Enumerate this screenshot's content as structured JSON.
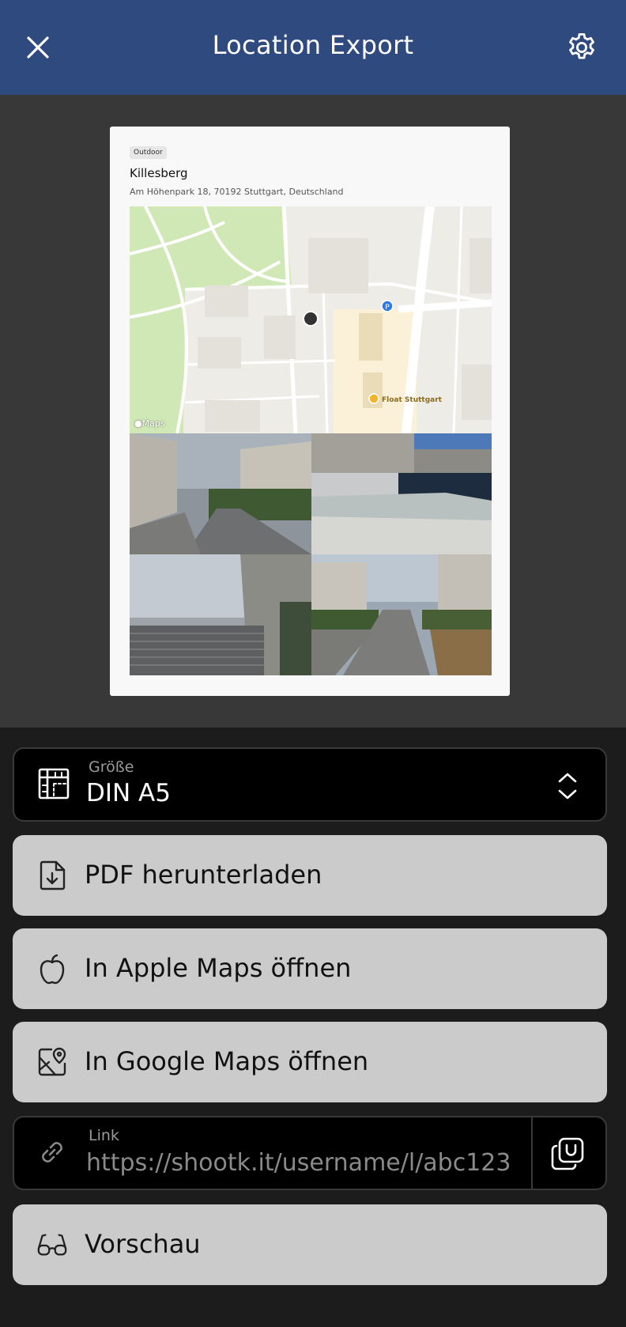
{
  "header": {
    "title": "Location Export",
    "close_icon": "close-icon",
    "settings_icon": "gear-icon",
    "background": "#2f4a7f"
  },
  "preview": {
    "tag": "Outdoor",
    "name": "Killesberg",
    "address": "Am Höhenpark 18, 70192 Stuttgart, Deutschland",
    "map": {
      "attribution": "Maps",
      "poi_label": "Float Stuttgart",
      "parking_marker": "P"
    },
    "photos": [
      "photo-street-buildings",
      "photo-fountain-plaza",
      "photo-stairs",
      "photo-walkway"
    ]
  },
  "size_select": {
    "label": "Größe",
    "value": "DIN A5",
    "icon": "ruler-layout-icon"
  },
  "actions": {
    "pdf_label": "PDF herunterladen",
    "apple_maps_label": "In Apple Maps öffnen",
    "google_maps_label": "In Google Maps öffnen",
    "preview_label": "Vorschau"
  },
  "link": {
    "label": "Link",
    "value": "https://shootk.it/username/l/abc123",
    "copy_icon": "copy-icon"
  }
}
